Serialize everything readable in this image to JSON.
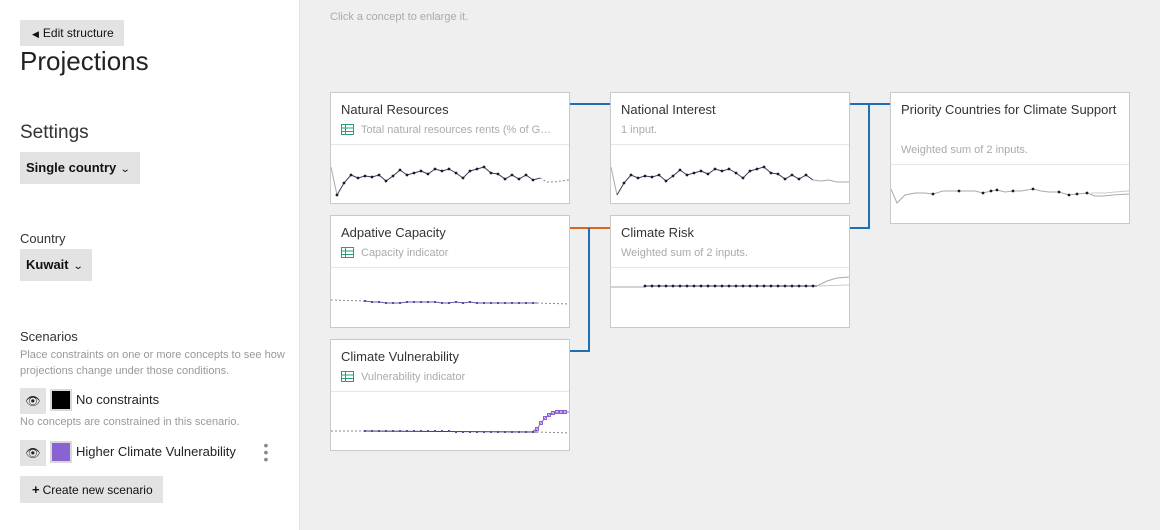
{
  "sidebar": {
    "edit_button": "Edit structure",
    "page_title": "Projections",
    "settings_title": "Settings",
    "mode_dropdown": "Single country",
    "country_label": "Country",
    "country_dropdown": "Kuwait",
    "scenarios_title": "Scenarios",
    "scenarios_help": "Place constraints on one or more concepts to see how projections change under those conditions.",
    "scenarios": [
      {
        "name": "No constraints",
        "color": "#000000",
        "note": "No concepts are constrained in this scenario."
      },
      {
        "name": "Higher Climate Vulnerability",
        "color": "#8a63d2"
      }
    ],
    "create_button": "Create new scenario",
    "icons": {
      "eye": "eye-icon",
      "caret_left": "caret-left-icon",
      "chevron_down": "chevron-down-icon",
      "kebab": "kebab-menu-icon",
      "plus": "plus-icon"
    }
  },
  "main": {
    "hint": "Click a concept to enlarge it.",
    "link_colors": {
      "blue": "#1f6fb2",
      "orange": "#d9661a"
    },
    "cards": {
      "natural_resources": {
        "title": "Natural Resources",
        "subtitle": "Total natural resources rents (% of GDP)",
        "has_table_icon": true
      },
      "national_interest": {
        "title": "National Interest",
        "subtitle": "1 input."
      },
      "priority": {
        "title": "Priority Countries for Climate Support",
        "subtitle": "Weighted sum of 2 inputs."
      },
      "adaptive_capacity": {
        "title": "Adpative Capacity",
        "subtitle": "Capacity indicator",
        "has_table_icon": true
      },
      "climate_risk": {
        "title": "Climate Risk",
        "subtitle": "Weighted sum of 2 inputs."
      },
      "climate_vulnerability": {
        "title": "Climate Vulnerability",
        "subtitle": "Vulnerability indicator",
        "has_table_icon": true
      }
    }
  }
}
